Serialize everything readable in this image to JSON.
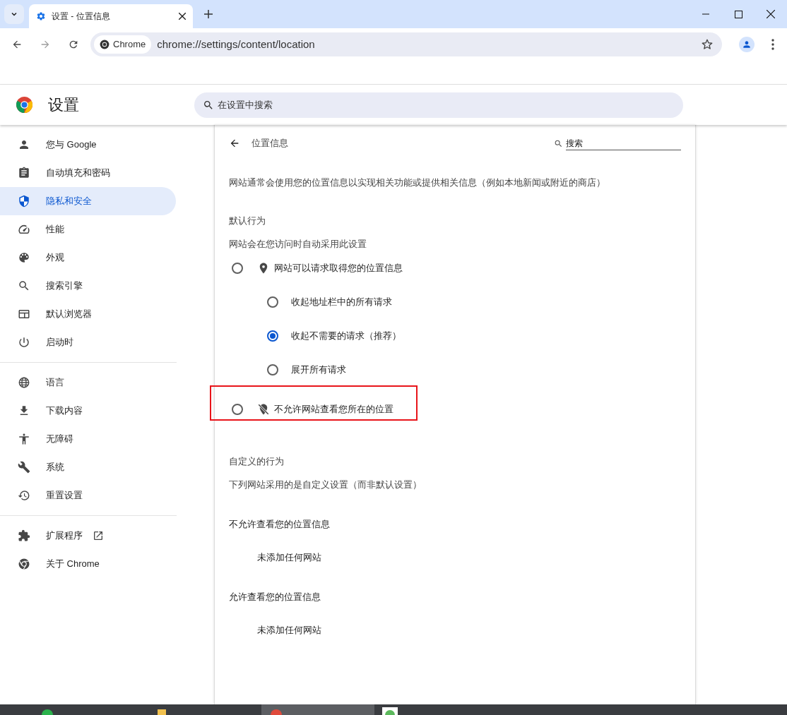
{
  "tabs": [
    {
      "title": "设置 - 位置信息",
      "selected": true
    }
  ],
  "address_bar": {
    "chip": "Chrome",
    "url": "chrome://settings/content/location"
  },
  "settings_header": {
    "title": "设置",
    "search_placeholder": "在设置中搜索"
  },
  "sidebar": {
    "groups": [
      {
        "items": [
          {
            "label": "您与 Google",
            "selected": false
          },
          {
            "label": "自动填充和密码",
            "selected": false
          },
          {
            "label": "隐私和安全",
            "selected": true
          },
          {
            "label": "性能",
            "selected": false
          },
          {
            "label": "外观",
            "selected": false
          },
          {
            "label": "搜索引擎",
            "selected": false
          },
          {
            "label": "默认浏览器",
            "selected": false
          },
          {
            "label": "启动时",
            "selected": false
          }
        ]
      },
      {
        "items": [
          {
            "label": "语言",
            "selected": false
          },
          {
            "label": "下载内容",
            "selected": false
          },
          {
            "label": "无障碍",
            "selected": false
          },
          {
            "label": "系统",
            "selected": false
          },
          {
            "label": "重置设置",
            "selected": false
          }
        ]
      },
      {
        "items": [
          {
            "label": "扩展程序",
            "selected": false,
            "external": true
          },
          {
            "label": "关于 Chrome",
            "selected": false,
            "external": false
          }
        ]
      }
    ]
  },
  "page": {
    "title": "位置信息",
    "search_placeholder": "搜索",
    "description": "网站通常会使用您的位置信息以实现相关功能或提供相关信息（例如本地新闻或附近的商店）",
    "default_behavior": {
      "heading": "默认行为",
      "subtitle": "网站会在您访问时自动采用此设置",
      "options": [
        {
          "label": "网站可以请求取得您的位置信息",
          "selected": false,
          "highlighted": false,
          "children": [
            {
              "label": "收起地址栏中的所有请求",
              "selected": false
            },
            {
              "label": "收起不需要的请求（推荐）",
              "selected": true
            },
            {
              "label": "展开所有请求",
              "selected": false
            }
          ]
        },
        {
          "label": "不允许网站查看您所在的位置",
          "selected": false,
          "highlighted": true
        }
      ]
    },
    "custom_behavior": {
      "heading": "自定义的行为",
      "subtitle": "下列网站采用的是自定义设置（而非默认设置）",
      "lists": [
        {
          "heading": "不允许查看您的位置信息",
          "empty_text": "未添加任何网站"
        },
        {
          "heading": "允许查看您的位置信息",
          "empty_text": "未添加任何网站"
        }
      ]
    }
  }
}
